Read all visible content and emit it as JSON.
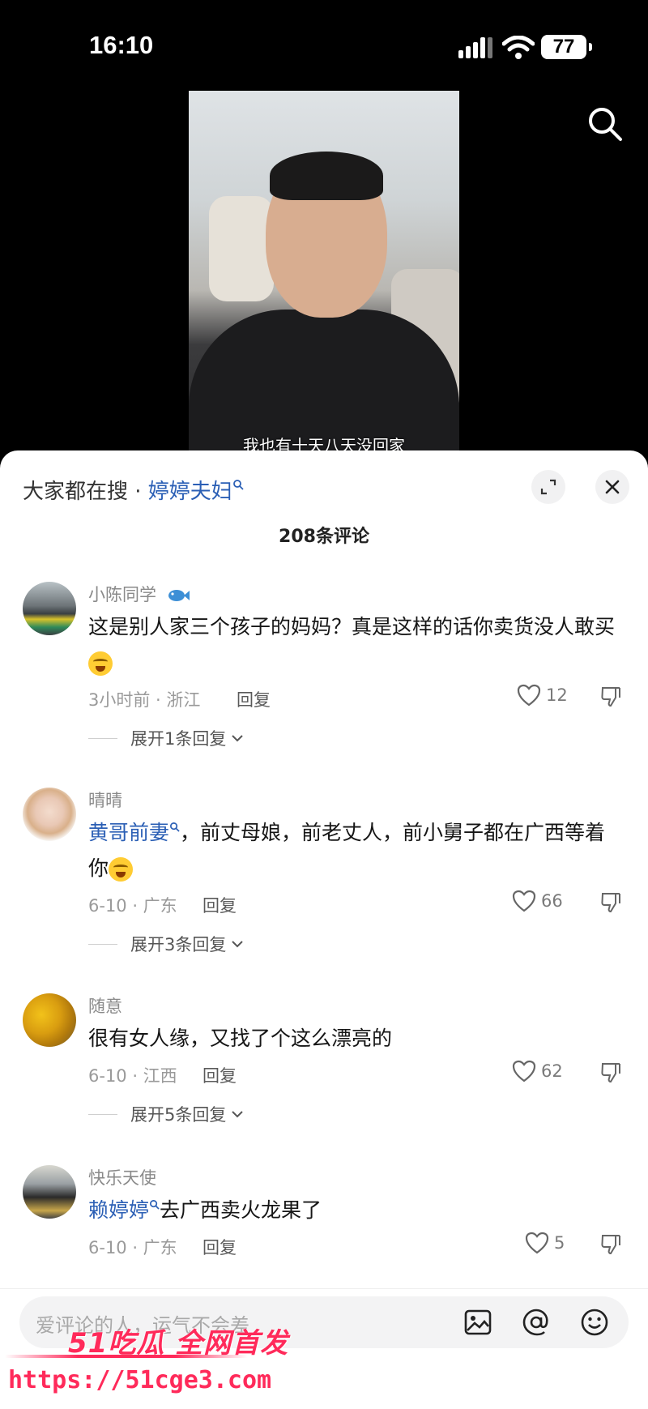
{
  "status_bar": {
    "time": "16:10",
    "battery": "77"
  },
  "video": {
    "caption": "我也有十天八天没回家"
  },
  "sheet": {
    "hot_search_prefix": "大家都在搜 · ",
    "hot_search_term": "婷婷夫妇",
    "comment_count": "208条评论"
  },
  "comments": [
    {
      "username": "小陈同学",
      "text": "这是别人家三个孩子的妈妈？真是这样的话你卖货没人敢买",
      "time_location": "3小时前 · 浙江",
      "reply_label": "回复",
      "likes": "12",
      "expand_label": "展开1条回复"
    },
    {
      "username": "晴晴",
      "link_text": "黄哥前妻",
      "text": "，前丈母娘，前老丈人，前小舅子都在广西等着你",
      "time_location": "6-10 · 广东",
      "reply_label": "回复",
      "likes": "66",
      "expand_label": "展开3条回复"
    },
    {
      "username": "随意",
      "text": "很有女人缘，又找了个这么漂亮的",
      "time_location": "6-10 · 江西",
      "reply_label": "回复",
      "likes": "62",
      "expand_label": "展开5条回复"
    },
    {
      "username": "快乐天使",
      "link_text": "赖婷婷",
      "text": "去广西卖火龙果了",
      "time_location": "6-10 · 广东",
      "reply_label": "回复",
      "likes": "5"
    }
  ],
  "input": {
    "placeholder": "爱评论的人，运气不会差"
  },
  "watermark": {
    "brand": "51吃瓜 全网首发",
    "url": "https://51cge3.com"
  },
  "colors": {
    "link": "#2b5fb5",
    "watermark": "#ff2a5a"
  }
}
